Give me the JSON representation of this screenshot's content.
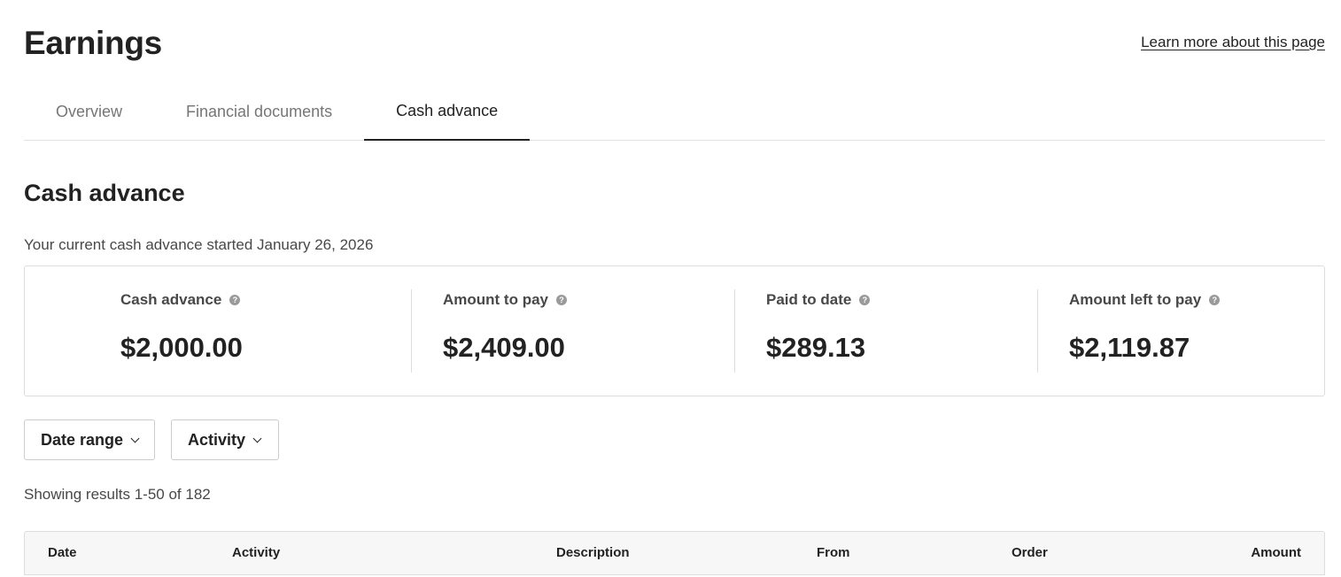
{
  "header": {
    "title": "Earnings",
    "learn_more_link": "Learn more about this page"
  },
  "tabs": [
    {
      "label": "Overview",
      "active": false
    },
    {
      "label": "Financial documents",
      "active": false
    },
    {
      "label": "Cash advance",
      "active": true
    }
  ],
  "cash_advance": {
    "section_title": "Cash advance",
    "started_text": "Your current cash advance started January 26, 2026",
    "stats": [
      {
        "label": "Cash advance",
        "value": "$2,000.00",
        "icon": "help-icon"
      },
      {
        "label": "Amount to pay",
        "value": "$2,409.00",
        "icon": "help-icon"
      },
      {
        "label": "Paid to date",
        "value": "$289.13",
        "icon": "help-icon"
      },
      {
        "label": "Amount left to pay",
        "value": "$2,119.87",
        "icon": "help-icon"
      }
    ]
  },
  "filters": {
    "date_range_label": "Date range",
    "activity_label": "Activity"
  },
  "results": {
    "summary": "Showing results 1-50 of 182"
  },
  "table": {
    "columns": [
      "Date",
      "Activity",
      "Description",
      "From",
      "Order",
      "Amount"
    ]
  },
  "colors": {
    "text_primary": "#222222",
    "text_secondary": "#484848",
    "text_muted": "#767676",
    "border": "#dddddd",
    "table_header_bg": "#f7f7f7"
  }
}
